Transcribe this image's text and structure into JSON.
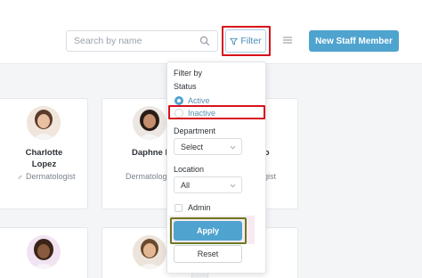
{
  "header": {
    "search_placeholder": "Search by name",
    "filter_label": "Filter",
    "new_staff_label": "New Staff Member"
  },
  "cards": [
    {
      "name": "Charlotte",
      "name2": "Lopez",
      "role": "Dermatologist"
    },
    {
      "name": "Daphne D",
      "role": "Dermatolog"
    },
    {
      "name_fragment": "go",
      "role_fragment": "ogist"
    }
  ],
  "filter": {
    "title": "Filter by",
    "status_label": "Status",
    "status_options": [
      "Active",
      "Inactive"
    ],
    "status_selected": "Active",
    "department_label": "Department",
    "department_value": "Select",
    "location_label": "Location",
    "location_value": "All",
    "admin_label": "Admin",
    "apply_label": "Apply",
    "reset_label": "Reset"
  },
  "colors": {
    "accent": "#4fa3cf",
    "highlight": "#d8121b",
    "apply_highlight": "#6b7a1e"
  }
}
